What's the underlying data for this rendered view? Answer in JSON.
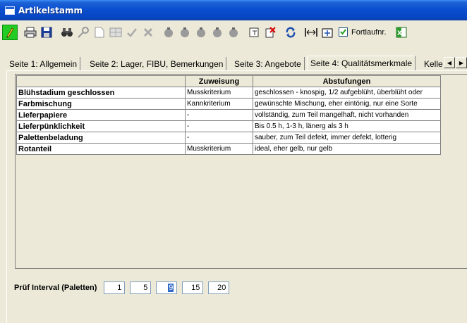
{
  "window": {
    "title": "Artikelstamm"
  },
  "toolbar": {
    "icons": [
      "pencil-edit",
      "print",
      "save",
      "binoculars-search",
      "key",
      "new-document",
      "grid-image",
      "check-mark",
      "delete-x",
      "nav-first",
      "nav-prev",
      "nav-next",
      "nav-last",
      "nav-record",
      "window-split",
      "delete-record",
      "refresh",
      "fit-width",
      "fit-page",
      "excel-export"
    ],
    "fortlauf": {
      "label": "Fortlaufnr.",
      "checked": true
    }
  },
  "tabs": [
    {
      "label": "Seite 1: Allgemein",
      "selected": false
    },
    {
      "label": "Seite 2: Lager, FIBU, Bemerkungen",
      "selected": false
    },
    {
      "label": "Seite 3: Angebote",
      "selected": false
    },
    {
      "label": "Seite 4: Qualitätsmerkmale",
      "selected": true
    },
    {
      "label": "Kelle",
      "selected": false
    }
  ],
  "grid": {
    "columns": [
      "",
      "Zuweisung",
      "Abstufungen"
    ],
    "rows": [
      {
        "name": "Blühstadium geschlossen",
        "zuweisung": "Musskriterium",
        "abstufungen": "geschlossen - knospig, 1/2 aufgeblüht, überblüht oder"
      },
      {
        "name": "Farbmischung",
        "zuweisung": "Kannkriterium",
        "abstufungen": "gewünschte Mischung, eher eintönig, nur eine Sorte"
      },
      {
        "name": "Lieferpapiere",
        "zuweisung": "-",
        "abstufungen": "vollständig, zum Teil mangelhaft, nicht vorhanden"
      },
      {
        "name": "Lieferpünklichkeit",
        "zuweisung": "-",
        "abstufungen": "Bis 0.5 h, 1-3 h, länerg als 3 h"
      },
      {
        "name": "Palettenbeladung",
        "zuweisung": "-",
        "abstufungen": "sauber, zum Teil defekt, immer defekt, lotterig"
      },
      {
        "name": "Rotanteil",
        "zuweisung": "Musskriterium",
        "abstufungen": "ideal, eher gelb, nur gelb"
      }
    ]
  },
  "interval": {
    "label": "Prüf Interval (Paletten)",
    "values": [
      "1",
      "5",
      "9",
      "15",
      "20"
    ]
  }
}
